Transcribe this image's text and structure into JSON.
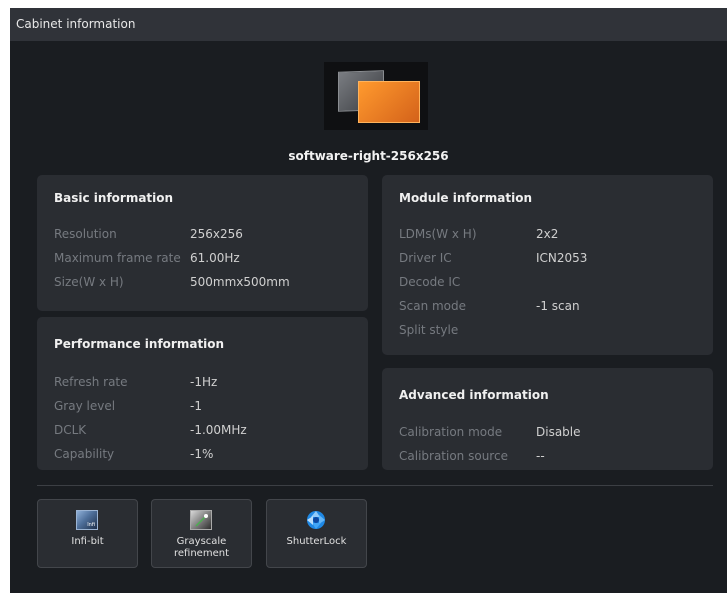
{
  "window": {
    "title": "Cabinet information"
  },
  "cabinet": {
    "name": "software-right-256x256"
  },
  "basic_info": {
    "title": "Basic information",
    "rows": [
      {
        "label": "Resolution",
        "value": "256x256"
      },
      {
        "label": "Maximum frame rate",
        "value": "61.00Hz"
      },
      {
        "label": "Size(W x H)",
        "value": "500mmx500mm"
      }
    ]
  },
  "performance_info": {
    "title": "Performance information",
    "rows": [
      {
        "label": "Refresh rate",
        "value": "-1Hz"
      },
      {
        "label": "Gray level",
        "value": "-1"
      },
      {
        "label": "DCLK",
        "value": "-1.00MHz"
      },
      {
        "label": "Capability",
        "value": "-1%"
      }
    ]
  },
  "module_info": {
    "title": "Module information",
    "rows": [
      {
        "label": "LDMs(W x H)",
        "value": "2x2"
      },
      {
        "label": "Driver IC",
        "value": "ICN2053"
      },
      {
        "label": "Decode IC",
        "value": ""
      },
      {
        "label": "Scan mode",
        "value": "-1 scan"
      },
      {
        "label": "Split style",
        "value": ""
      }
    ]
  },
  "advanced_info": {
    "title": "Advanced information",
    "rows": [
      {
        "label": "Calibration mode",
        "value": "Disable"
      },
      {
        "label": "Calibration source",
        "value": "--"
      }
    ]
  },
  "features": {
    "infibit": {
      "label": "Infi-bit",
      "icon_text": "Infi",
      "icon": "infi-bit-icon"
    },
    "grayscale": {
      "label_line1": "Grayscale",
      "label_line2": "refinement",
      "icon": "grayscale-refinement-icon"
    },
    "shutterlock": {
      "label": "ShutterLock",
      "icon": "shutter-aperture-icon"
    }
  },
  "colors": {
    "background": "#1a1d21",
    "titlebar": "#303339",
    "panel": "#2a2d32",
    "label": "#767a80",
    "value": "#d0d0d0",
    "accent_orange": "#f08a24",
    "shutter_blue": "#1e88e5"
  }
}
